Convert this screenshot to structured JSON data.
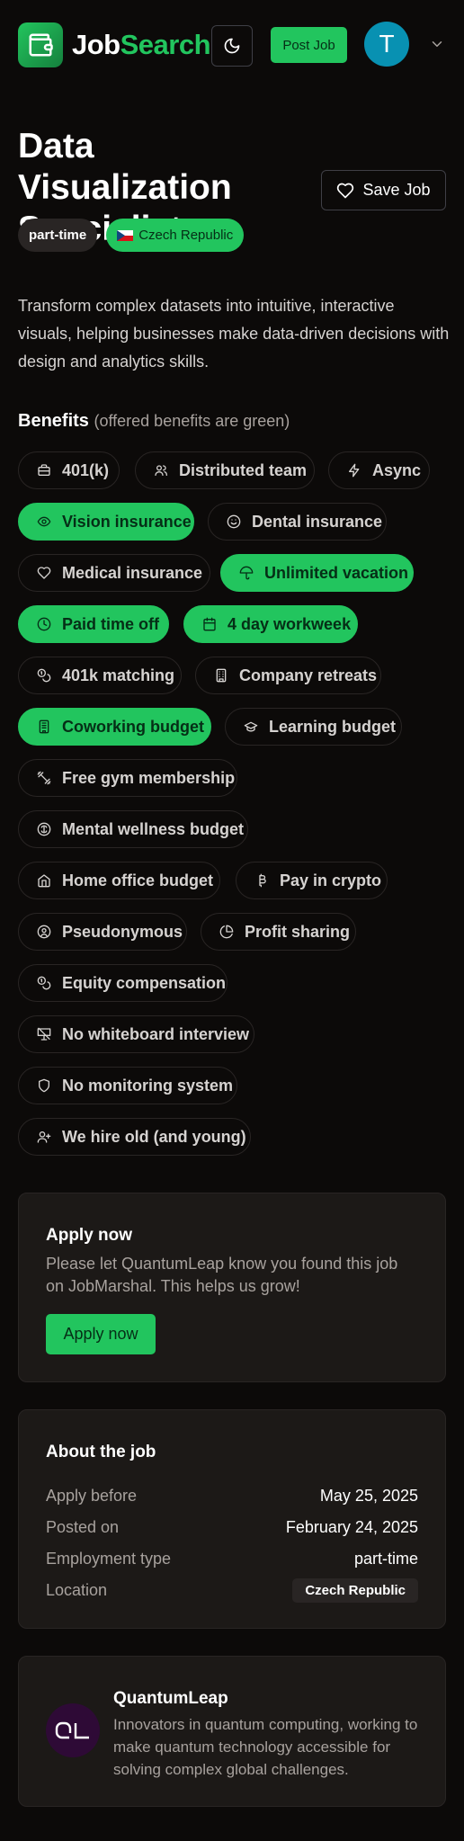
{
  "header": {
    "logo_first": "Job",
    "logo_second": "Search",
    "post_job": "Post Job",
    "avatar_initial": "T"
  },
  "job": {
    "title": "Data Visualization Specialist",
    "save_label": "Save Job",
    "tags": [
      "part-time",
      "Czech Republic"
    ],
    "description": "Transform complex datasets into intuitive, interactive visuals, helping businesses make data-driven decisions with design and analytics skills."
  },
  "benefits": {
    "heading": "Benefits",
    "note": "(offered benefits are green)",
    "items": [
      {
        "label": "401(k)",
        "offered": false,
        "icon": "briefcase-icon"
      },
      {
        "label": "Distributed team",
        "offered": false,
        "icon": "users-icon"
      },
      {
        "label": "Async",
        "offered": false,
        "icon": "lightning-icon"
      },
      {
        "label": "Vision insurance",
        "offered": true,
        "icon": "eye-icon"
      },
      {
        "label": "Dental insurance",
        "offered": false,
        "icon": "smile-icon"
      },
      {
        "label": "Medical insurance",
        "offered": false,
        "icon": "heart-icon"
      },
      {
        "label": "Unlimited vacation",
        "offered": true,
        "icon": "umbrella-icon"
      },
      {
        "label": "Paid time off",
        "offered": true,
        "icon": "clock-icon"
      },
      {
        "label": "4 day workweek",
        "offered": true,
        "icon": "calendar-icon"
      },
      {
        "label": "401k matching",
        "offered": false,
        "icon": "coins-icon"
      },
      {
        "label": "Company retreats",
        "offered": false,
        "icon": "building-icon"
      },
      {
        "label": "Coworking budget",
        "offered": true,
        "icon": "office-icon"
      },
      {
        "label": "Learning budget",
        "offered": false,
        "icon": "graduation-cap-icon"
      },
      {
        "label": "Free gym membership",
        "offered": false,
        "icon": "dumbbell-icon"
      },
      {
        "label": "Mental wellness budget",
        "offered": false,
        "icon": "brain-icon"
      },
      {
        "label": "Home office budget",
        "offered": false,
        "icon": "home-icon"
      },
      {
        "label": "Pay in crypto",
        "offered": false,
        "icon": "bitcoin-icon"
      },
      {
        "label": "Pseudonymous",
        "offered": false,
        "icon": "user-circle-icon"
      },
      {
        "label": "Profit sharing",
        "offered": false,
        "icon": "pie-chart-icon"
      },
      {
        "label": "Equity compensation",
        "offered": false,
        "icon": "coins-icon"
      },
      {
        "label": "No whiteboard interview",
        "offered": false,
        "icon": "no-presentation-icon"
      },
      {
        "label": "No monitoring system",
        "offered": false,
        "icon": "shield-icon"
      },
      {
        "label": "We hire old (and young)",
        "offered": false,
        "icon": "user-plus-icon"
      }
    ]
  },
  "apply": {
    "title": "Apply now",
    "text": "Please let QuantumLeap know you found this job on JobMarshal. This helps us grow!",
    "button": "Apply now"
  },
  "about": {
    "title": "About the job",
    "rows": [
      {
        "key": "Apply before",
        "value": "May 25, 2025"
      },
      {
        "key": "Posted on",
        "value": "February 24, 2025"
      },
      {
        "key": "Employment type",
        "value": "part-time"
      },
      {
        "key": "Location",
        "value": "Czech Republic"
      }
    ]
  },
  "company": {
    "name": "QuantumLeap",
    "logo_text": "QL",
    "description": "Innovators in quantum computing, working to make quantum technology accessible for solving complex global challenges."
  },
  "colors": {
    "accent": "#22c55e",
    "background": "#0c0a09",
    "avatar": "#0891b2"
  }
}
